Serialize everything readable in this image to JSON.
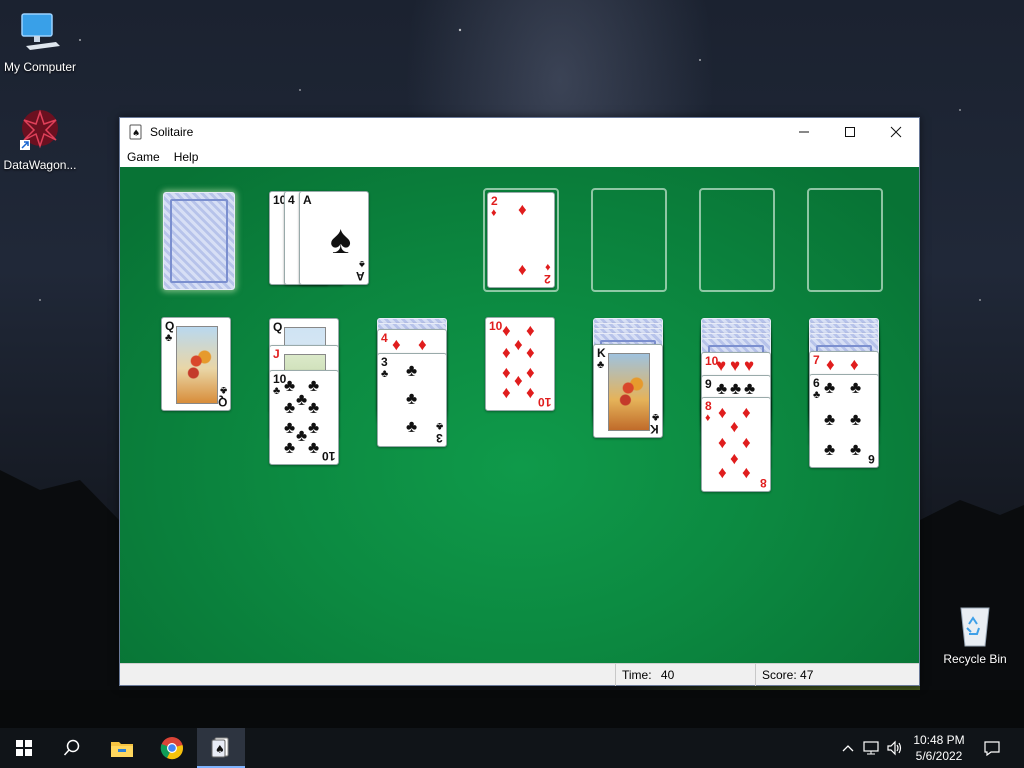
{
  "desktop": {
    "icons": [
      {
        "label": "My Computer",
        "icon": "computer-icon"
      },
      {
        "label": "DataWagon...",
        "icon": "app-shortcut-icon"
      },
      {
        "label": "Recycle Bin",
        "icon": "recycle-bin-icon"
      }
    ]
  },
  "window": {
    "title": "Solitaire",
    "menu": [
      "Game",
      "Help"
    ],
    "controls": {
      "minimize": "minimize-icon",
      "maximize": "maximize-icon",
      "close": "close-icon"
    },
    "status": {
      "time_label": "Time:",
      "time_value": "40",
      "score_label": "Score: 47"
    }
  },
  "game": {
    "stock": {
      "state": "face-down"
    },
    "waste": {
      "visible_ranks": [
        "10",
        "4",
        "A"
      ],
      "top_card": {
        "rank": "A",
        "suit": "♠"
      }
    },
    "foundations": [
      {
        "rank": "2",
        "suit": "♦"
      },
      null,
      null,
      null
    ],
    "tableau": [
      {
        "hidden": 0,
        "cards": [
          {
            "rank": "Q",
            "suit": "♣"
          }
        ]
      },
      {
        "hidden": 0,
        "cards": [
          {
            "rank": "Q",
            "suit": "♠"
          },
          {
            "rank": "J",
            "suit": "♦"
          },
          {
            "rank": "10",
            "suit": "♣"
          }
        ]
      },
      {
        "hidden": 2,
        "cards": [
          {
            "rank": "4",
            "suit": "♦"
          },
          {
            "rank": "3",
            "suit": "♣"
          }
        ]
      },
      {
        "hidden": 0,
        "cards": [
          {
            "rank": "10",
            "suit": "♦"
          }
        ]
      },
      {
        "hidden": 4,
        "cards": [
          {
            "rank": "K",
            "suit": "♣"
          }
        ]
      },
      {
        "hidden": 5,
        "cards": [
          {
            "rank": "10",
            "suit": "♥"
          },
          {
            "rank": "9",
            "suit": "♣"
          },
          {
            "rank": "8",
            "suit": "♦"
          }
        ]
      },
      {
        "hidden": 5,
        "cards": [
          {
            "rank": "7",
            "suit": "♦"
          },
          {
            "rank": "6",
            "suit": "♣"
          }
        ]
      }
    ]
  },
  "taskbar": {
    "items": [
      "start-icon",
      "search-icon",
      "file-explorer-icon",
      "chrome-icon",
      "solitaire-icon"
    ],
    "clock_time": "10:48 PM",
    "clock_date": "5/6/2022"
  }
}
